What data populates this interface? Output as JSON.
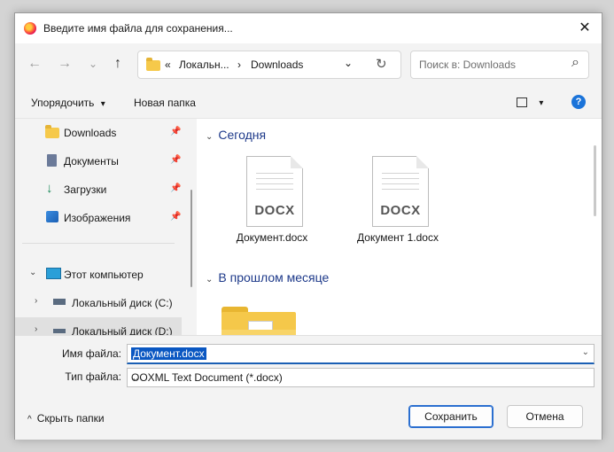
{
  "window": {
    "title": "Введите имя файла для сохранения...",
    "close_label": "✕"
  },
  "nav": {
    "back": "←",
    "forward": "→",
    "recent": "⌄",
    "up": "↑",
    "path": [
      "«",
      "Локальн...",
      "›",
      "Downloads"
    ],
    "path_dropdown": "⌄",
    "refresh": "↻",
    "search_placeholder": "Поиск в: Downloads",
    "search_icon": "⌕"
  },
  "toolbar": {
    "organize_label": "Упорядочить",
    "organize_caret": "▾",
    "new_folder_label": "Новая папка",
    "view_caret": "▾",
    "help_label": "?"
  },
  "sidebar": {
    "quick": [
      {
        "label": "Downloads",
        "icon": "folder-icon"
      },
      {
        "label": "Документы",
        "icon": "documents-icon"
      },
      {
        "label": "Загрузки",
        "icon": "download-arrow-icon"
      },
      {
        "label": "Изображения",
        "icon": "pictures-icon"
      }
    ],
    "pin_glyph": "📌",
    "this_pc": "Этот компьютер",
    "drives": [
      "Локальный диск (C:)",
      "Локальный диск (D:)"
    ],
    "expanded_chevron": "⌄",
    "collapsed_chevron": "›"
  },
  "main": {
    "groups": [
      {
        "title": "Сегодня"
      },
      {
        "title": "В прошлом месяце"
      }
    ],
    "files": [
      {
        "name": "Документ.docx",
        "ext": "DOCX"
      },
      {
        "name": "Документ 1.docx",
        "ext": "DOCX"
      }
    ]
  },
  "form": {
    "filename_label": "Имя файла:",
    "filename_value": "Документ.docx",
    "filetype_label": "Тип файла:",
    "filetype_value": "OOXML Text Document (*.docx)",
    "dropdown_caret": "⌄"
  },
  "footer": {
    "hide_folders_label": "Скрыть папки",
    "hide_folders_caret": "^",
    "save_label": "Сохранить",
    "cancel_label": "Отмена"
  },
  "colors": {
    "accent": "#1a5fb4",
    "folder": "#f6c94a",
    "heading": "#1e3a8a"
  }
}
